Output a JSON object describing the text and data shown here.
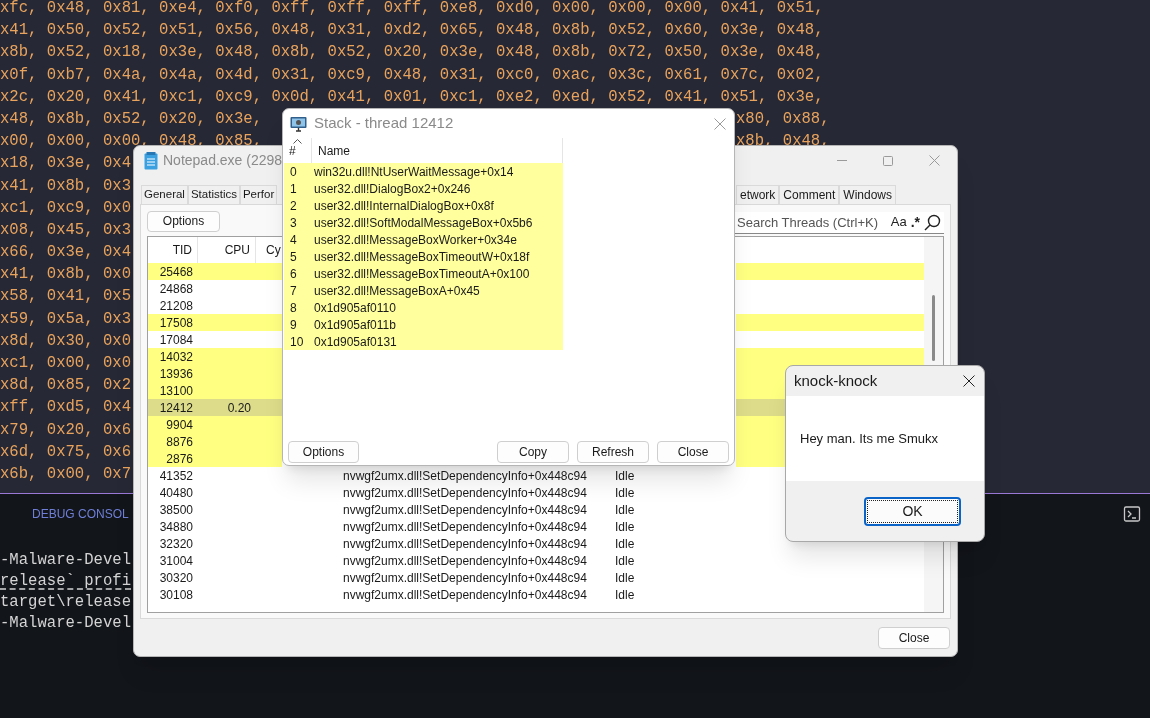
{
  "editor": {
    "code_lines": [
      {
        "text": "xfc, 0x48, 0x81, 0xe4, 0xf0, 0xff, 0xff, 0xff, 0xe8, 0xd0, 0x00, 0x00, 0x00, 0x41, 0x51,"
      },
      {
        "text": "x41, 0x50, 0x52, 0x51, 0x56, 0x48, 0x31, 0xd2, 0x65, 0x48, 0x8b, 0x52, 0x60, 0x3e, 0x48,"
      },
      {
        "text": "x8b, 0x52, 0x18, 0x3e, 0x48, 0x8b, 0x52, 0x20, 0x3e, 0x48, 0x8b, 0x72, 0x50, 0x3e, 0x48,"
      },
      {
        "text": "x0f, 0xb7, 0x4a, 0x4a, 0x4d, 0x31, 0xc9, 0x48, 0x31, 0xc0, 0xac, 0x3c, 0x61, 0x7c, 0x02,"
      },
      {
        "text": "x2c, 0x20, 0x41, 0xc1, 0xc9, 0x0d, 0x41, 0x01, 0xc1, 0xe2, 0xed, 0x52, 0x41, 0x51, 0x3e,"
      },
      {
        "text": "x48, 0x8b, 0x52, 0x20, 0x3e,",
        "right_text": "x80, 0x88,"
      },
      {
        "text": "x00, 0x00, 0x00, 0x48, 0x85,",
        "right_text": "x8b, 0x48,"
      },
      {
        "text": "x18, 0x3e, 0x4"
      },
      {
        "text": "x41, 0x8b, 0x3"
      },
      {
        "text": "xc1, 0xc9, 0x0"
      },
      {
        "text": "x08, 0x45, 0x3"
      },
      {
        "text": "x66, 0x3e, 0x4"
      },
      {
        "text": "x41, 0x8b, 0x0"
      },
      {
        "text": "x58, 0x41, 0x5"
      },
      {
        "text": "x59, 0x5a, 0x3"
      },
      {
        "text": "x8d, 0x30, 0x0"
      },
      {
        "text": "xc1, 0x00, 0x0"
      },
      {
        "text": "x8d, 0x85, 0x2"
      },
      {
        "text": "xff, 0xd5, 0x4"
      },
      {
        "text": "x79, 0x20, 0x6"
      },
      {
        "text": "x6d, 0x75, 0x6"
      },
      {
        "text": "x6b, 0x00, 0x7"
      }
    ]
  },
  "panel": {
    "tab_label": "DEBUG CONSOL",
    "terminal_lines": [
      {
        "text": "-Malware-Devel",
        "underlined": false
      },
      {
        "text": "release` profi",
        "underlined": true
      },
      {
        "text": "target\\release",
        "underlined": false
      },
      {
        "text": "-Malware-Devel",
        "underlined": false
      }
    ]
  },
  "process_window": {
    "title": "Notepad.exe (2298",
    "tabs": {
      "left": [
        {
          "label": "General",
          "selected": false
        },
        {
          "label": "Statistics",
          "selected": false
        },
        {
          "label": "Perfor",
          "selected": false
        }
      ],
      "right": [
        {
          "label": "etwork",
          "selected": false
        },
        {
          "label": "Comment",
          "selected": false
        },
        {
          "label": "Windows",
          "selected": false
        }
      ]
    },
    "options_button": "Options",
    "search": {
      "placeholder": "Search Threads (Ctrl+K)"
    },
    "search_toggles": [
      "Aa",
      ".*"
    ],
    "columns": [
      "TID",
      "CPU",
      "Cy"
    ],
    "threads": [
      {
        "tid": "25468",
        "highlighted": true,
        "selected": false
      },
      {
        "tid": "24868",
        "highlighted": false,
        "selected": false
      },
      {
        "tid": "21208",
        "highlighted": false,
        "selected": false
      },
      {
        "tid": "17508",
        "highlighted": true,
        "selected": false
      },
      {
        "tid": "17084",
        "highlighted": false,
        "selected": false
      },
      {
        "tid": "14032",
        "highlighted": true,
        "selected": false
      },
      {
        "tid": "13936",
        "highlighted": true,
        "selected": false
      },
      {
        "tid": "13100",
        "highlighted": true,
        "selected": false
      },
      {
        "tid": "12412",
        "cpu": "0.20",
        "highlighted": true,
        "selected": true
      },
      {
        "tid": "9904",
        "highlighted": true,
        "selected": false
      },
      {
        "tid": "8876",
        "highlighted": true,
        "selected": false
      },
      {
        "tid": "2876",
        "highlighted": true,
        "selected": false
      },
      {
        "tid": "41352",
        "start_address": "nvwgf2umx.dll!SetDependencyInfo+0x448c94",
        "state": "Idle",
        "highlighted": false,
        "selected": false
      },
      {
        "tid": "40480",
        "start_address": "nvwgf2umx.dll!SetDependencyInfo+0x448c94",
        "state": "Idle",
        "highlighted": false,
        "selected": false
      },
      {
        "tid": "38500",
        "start_address": "nvwgf2umx.dll!SetDependencyInfo+0x448c94",
        "state": "Idle",
        "highlighted": false,
        "selected": false
      },
      {
        "tid": "34880",
        "start_address": "nvwgf2umx.dll!SetDependencyInfo+0x448c94",
        "state": "Idle",
        "highlighted": false,
        "selected": false
      },
      {
        "tid": "32320",
        "start_address": "nvwgf2umx.dll!SetDependencyInfo+0x448c94",
        "state": "Idle",
        "highlighted": false,
        "selected": false
      },
      {
        "tid": "31004",
        "start_address": "nvwgf2umx.dll!SetDependencyInfo+0x448c94",
        "state": "Idle",
        "highlighted": false,
        "selected": false
      },
      {
        "tid": "30320",
        "start_address": "nvwgf2umx.dll!SetDependencyInfo+0x448c94",
        "state": "Idle",
        "highlighted": false,
        "selected": false
      },
      {
        "tid": "30108",
        "start_address": "nvwgf2umx.dll!SetDependencyInfo+0x448c94",
        "state": "Idle",
        "highlighted": false,
        "selected": false
      }
    ],
    "close_button": "Close"
  },
  "stack_window": {
    "title": "Stack - thread 12412",
    "columns": [
      "#",
      "Name"
    ],
    "frames": [
      {
        "index": "0",
        "name": "win32u.dll!NtUserWaitMessage+0x14",
        "highlighted": true
      },
      {
        "index": "1",
        "name": "user32.dll!DialogBox2+0x246",
        "highlighted": true
      },
      {
        "index": "2",
        "name": "user32.dll!InternalDialogBox+0x8f",
        "highlighted": true
      },
      {
        "index": "3",
        "name": "user32.dll!SoftModalMessageBox+0x5b6",
        "highlighted": true
      },
      {
        "index": "4",
        "name": "user32.dll!MessageBoxWorker+0x34e",
        "highlighted": true
      },
      {
        "index": "5",
        "name": "user32.dll!MessageBoxTimeoutW+0x18f",
        "highlighted": true
      },
      {
        "index": "6",
        "name": "user32.dll!MessageBoxTimeoutA+0x100",
        "highlighted": true
      },
      {
        "index": "7",
        "name": "user32.dll!MessageBoxA+0x45",
        "highlighted": true
      },
      {
        "index": "8",
        "name": "0x1d905af0110",
        "highlighted": true
      },
      {
        "index": "9",
        "name": "0x1d905af011b",
        "highlighted": true
      },
      {
        "index": "10",
        "name": "0x1d905af0131",
        "highlighted": true
      }
    ],
    "left_button": "Options",
    "buttons": [
      "Copy",
      "Refresh",
      "Close"
    ]
  },
  "message_box": {
    "title": "knock-knock",
    "message": "Hey man. Its me Smukx",
    "ok_button": "OK"
  }
}
